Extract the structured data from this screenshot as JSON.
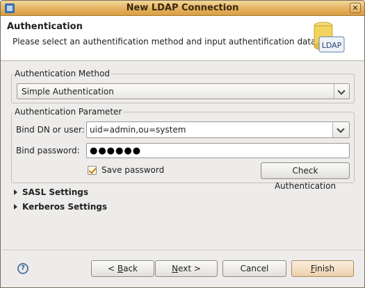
{
  "window": {
    "title": "New LDAP Connection",
    "close_glyph": "✕"
  },
  "banner": {
    "title": "Authentication",
    "description": "Please select an authentification method and input authentification data.",
    "icon_text": "LDAP"
  },
  "auth_method": {
    "group_label": "Authentication Method",
    "selected": "Simple Authentication"
  },
  "auth_params": {
    "group_label": "Authentication Parameter",
    "bind_dn_label": "Bind DN or user:",
    "bind_dn_value": "uid=admin,ou=system",
    "bind_password_label": "Bind password:",
    "bind_password_value": "●●●●●●",
    "save_password_label": "Save password",
    "save_password_checked": true,
    "check_button": "Check Authentication"
  },
  "sections": {
    "sasl": "SASL Settings",
    "kerberos": "Kerberos Settings"
  },
  "footer": {
    "help_glyph": "?",
    "back_mnemonic": "B",
    "back_rest": "ack",
    "back_prefix": "< ",
    "next_mnemonic": "N",
    "next_rest": "ext >",
    "cancel": "Cancel",
    "finish_mnemonic": "F",
    "finish_rest": "inish"
  },
  "colors": {
    "titlebar": "#e8b869",
    "accent_check": "#c07a10",
    "window_bg": "#edeceb"
  }
}
